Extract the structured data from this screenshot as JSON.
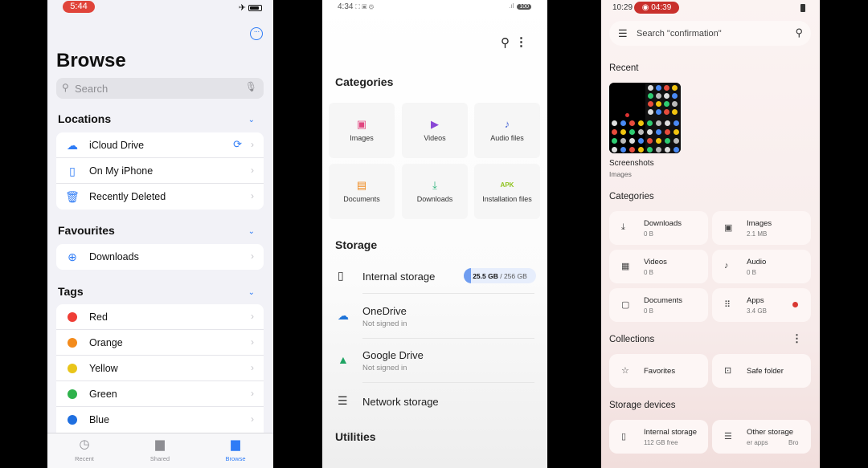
{
  "ios": {
    "status_time": "5:44",
    "title": "Browse",
    "search_placeholder": "Search",
    "locations": {
      "title": "Locations",
      "items": [
        {
          "label": "iCloud Drive"
        },
        {
          "label": "On My iPhone"
        },
        {
          "label": "Recently Deleted"
        }
      ]
    },
    "favourites": {
      "title": "Favourites",
      "items": [
        {
          "label": "Downloads"
        }
      ]
    },
    "tags": {
      "title": "Tags",
      "items": [
        {
          "label": "Red",
          "color": "#ef3e36"
        },
        {
          "label": "Orange",
          "color": "#f38b1c"
        },
        {
          "label": "Yellow",
          "color": "#e9c51a"
        },
        {
          "label": "Green",
          "color": "#2fb24c"
        },
        {
          "label": "Blue",
          "color": "#1f6fe0"
        }
      ]
    },
    "tabs": [
      {
        "label": "Recent"
      },
      {
        "label": "Shared"
      },
      {
        "label": "Browse"
      }
    ]
  },
  "samsung": {
    "status_time": "4:34",
    "battery": "100",
    "categories_title": "Categories",
    "categories": [
      {
        "label": "Images",
        "color": "#e0457f"
      },
      {
        "label": "Videos",
        "color": "#8a47d6"
      },
      {
        "label": "Audio files",
        "color": "#4d6ad6"
      },
      {
        "label": "Documents",
        "color": "#f08a1e"
      },
      {
        "label": "Downloads",
        "color": "#2bb37b"
      },
      {
        "label": "Installation files",
        "color": "#8fc31f",
        "glyph": "APK"
      }
    ],
    "storage_title": "Storage",
    "storage": [
      {
        "name": "Internal storage",
        "used": "25.5 GB",
        "total": "/ 256 GB",
        "used_fraction": 0.1
      },
      {
        "name": "OneDrive",
        "sub": "Not signed in"
      },
      {
        "name": "Google Drive",
        "sub": "Not signed in"
      },
      {
        "name": "Network storage"
      }
    ],
    "utilities_title": "Utilities"
  },
  "android": {
    "status_time": "10:29",
    "recording_time": "04:39",
    "search_placeholder": "Search \"confirmation\"",
    "recent_title": "Recent",
    "recent_item": {
      "name": "Screenshots",
      "sub": "Images"
    },
    "categories_title": "Categories",
    "categories": [
      {
        "name": "Downloads",
        "size": "0 B"
      },
      {
        "name": "Images",
        "size": "2.1 MB"
      },
      {
        "name": "Videos",
        "size": "0 B"
      },
      {
        "name": "Audio",
        "size": "0 B"
      },
      {
        "name": "Documents",
        "size": "0 B"
      },
      {
        "name": "Apps",
        "size": "3.4 GB"
      }
    ],
    "collections_title": "Collections",
    "collections": [
      {
        "name": "Favorites"
      },
      {
        "name": "Safe folder"
      }
    ],
    "storage_devices_title": "Storage devices",
    "storage_devices": [
      {
        "name": "Internal storage",
        "sub": "112 GB free"
      },
      {
        "name": "Other storage",
        "sub": "er apps",
        "sub2": "Bro"
      }
    ]
  }
}
